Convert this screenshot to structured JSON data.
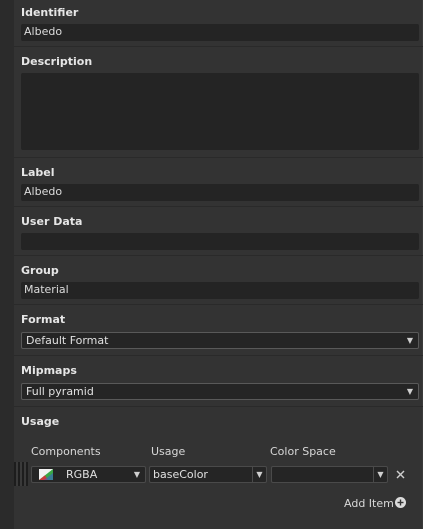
{
  "fields": {
    "identifier": {
      "label": "Identifier",
      "value": "Albedo"
    },
    "description": {
      "label": "Description",
      "value": ""
    },
    "label": {
      "label": "Label",
      "value": "Albedo"
    },
    "user_data": {
      "label": "User Data",
      "value": ""
    },
    "group": {
      "label": "Group",
      "value": "Material"
    },
    "format": {
      "label": "Format",
      "value": "Default Format"
    },
    "mipmaps": {
      "label": "Mipmaps",
      "value": "Full pyramid"
    }
  },
  "usage": {
    "title": "Usage",
    "columns": [
      "Components",
      "Usage",
      "Color Space"
    ],
    "row": {
      "components": "RGBA",
      "usage": "baseColor",
      "color_space": ""
    },
    "add_item_label": "Add Item"
  },
  "icons": {
    "dropdown": "chevron-down-icon",
    "remove": "close-icon",
    "add": "plus-circle-icon",
    "channels": "rgba-swatch-icon"
  },
  "colors": {
    "panel_bg": "#333333",
    "field_bg": "#242424",
    "text": "#d8d8d8"
  }
}
